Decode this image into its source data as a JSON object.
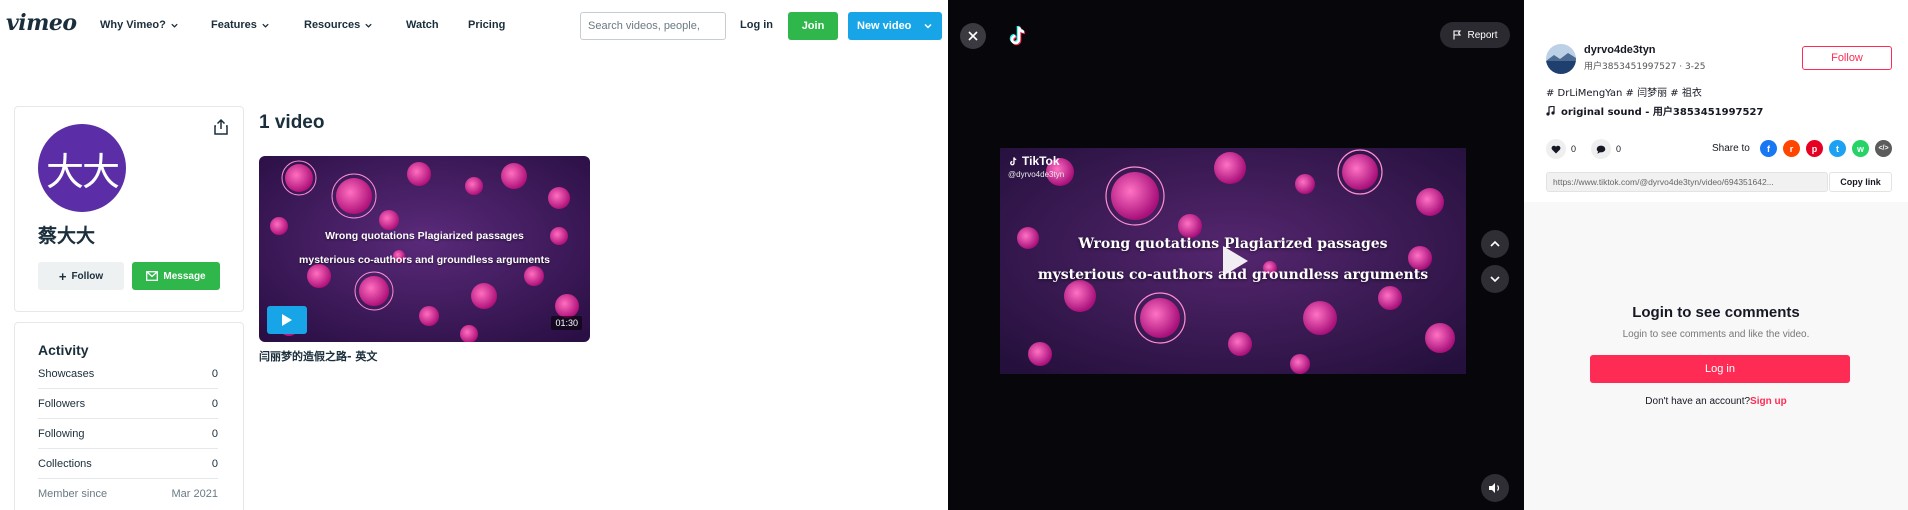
{
  "vimeo": {
    "logo": "vimeo",
    "nav": {
      "menus": [
        {
          "label": "Why Vimeo?",
          "has_caret": true
        },
        {
          "label": "Features",
          "has_caret": true
        },
        {
          "label": "Resources",
          "has_caret": true
        },
        {
          "label": "Watch",
          "has_caret": false
        },
        {
          "label": "Pricing",
          "has_caret": false
        }
      ],
      "search_placeholder": "Search videos, people,",
      "login_label": "Log in",
      "join_label": "Join",
      "new_video_label": "New video"
    },
    "profile": {
      "avatar_text": "大大",
      "name": "蔡大大",
      "follow_label": "Follow",
      "message_label": "Message"
    },
    "activity": {
      "title": "Activity",
      "rows": [
        {
          "label": "Showcases",
          "value": "0"
        },
        {
          "label": "Followers",
          "value": "0"
        },
        {
          "label": "Following",
          "value": "0"
        },
        {
          "label": "Collections",
          "value": "0"
        }
      ],
      "member_since_label": "Member since",
      "member_since_value": "Mar 2021"
    },
    "videos": {
      "count_label": "1 video",
      "items": [
        {
          "caption_line1": "Wrong quotations   Plagiarized passages",
          "caption_line2": "mysterious co-authors and groundless arguments",
          "duration": "01:30",
          "title": "闫丽梦的造假之路- 英文"
        }
      ]
    }
  },
  "tiktok": {
    "player": {
      "report_label": "Report",
      "watermark_brand": "TikTok",
      "watermark_handle": "@dyrvo4de3tyn",
      "caption_line1": "Wrong quotations   Plagiarized passages",
      "caption_line2": "mysterious co-authors and groundless arguments"
    },
    "author": {
      "username": "dyrvo4de3tyn",
      "subline": "用户3853451997527 · 3-25",
      "follow_label": "Follow"
    },
    "description": {
      "hashtags": "# DrLiMengYan  # 闫梦丽 # 祖衣",
      "sound": "original sound - 用户3853451997527"
    },
    "stats": {
      "likes": "0",
      "comments": "0",
      "share_to_label": "Share to"
    },
    "share_icons": [
      {
        "name": "facebook-icon",
        "glyph": "f",
        "color": "#1877f2"
      },
      {
        "name": "reddit-icon",
        "glyph": "r",
        "color": "#ff4500"
      },
      {
        "name": "pinterest-icon",
        "glyph": "p",
        "color": "#e60023"
      },
      {
        "name": "twitter-icon",
        "glyph": "t",
        "color": "#1da1f2"
      },
      {
        "name": "whatsapp-icon",
        "glyph": "w",
        "color": "#25d366"
      },
      {
        "name": "embed-icon",
        "glyph": "</>",
        "color": "#5c5c5c"
      }
    ],
    "link": {
      "url": "https://www.tiktok.com/@dyrvo4de3tyn/video/694351642...",
      "copy_label": "Copy link"
    },
    "comments_gate": {
      "title": "Login to see comments",
      "subtitle": "Login to see comments and like the video.",
      "login_label": "Log in",
      "no_account_text": "Don't have an account?",
      "signup_label": "Sign up"
    },
    "colors": {
      "brand_red": "#fe2c55",
      "player_bg": "#07070b"
    }
  }
}
